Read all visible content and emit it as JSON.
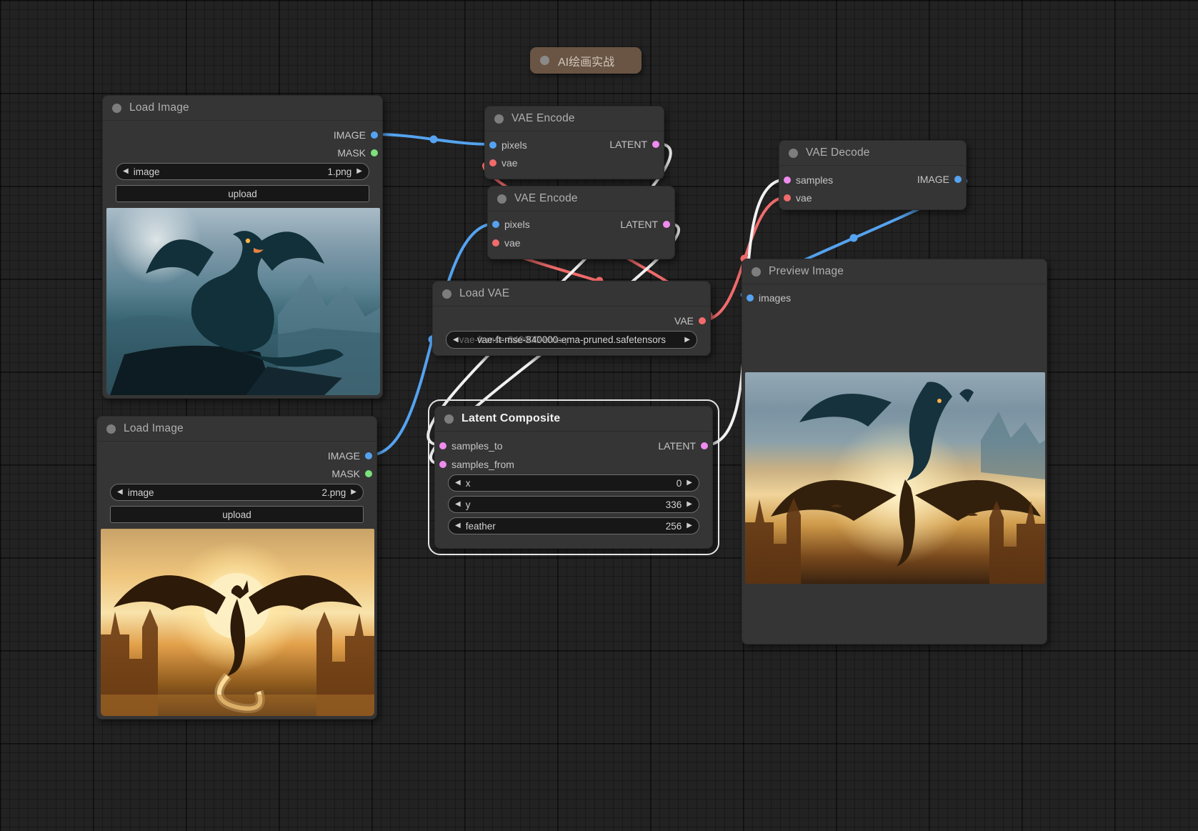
{
  "group": {
    "title": "AI绘画实战",
    "color": "#6a5443"
  },
  "icons": {
    "arrow_left": "◀",
    "arrow_right": "▶"
  },
  "colors": {
    "image_port": "#55a3f0",
    "mask_port": "#7ce07c",
    "latent_port": "#ef8bef",
    "vae_port": "#f26b6b",
    "image_wire": "#55a3f0",
    "vae_wire": "#f26b6b",
    "latent_wire": "#f2f2f2",
    "node_bg": "#353535",
    "selected_outline": "#e4e4e4"
  },
  "nodes": {
    "load_image_1": {
      "title": "Load Image",
      "outputs": {
        "image": "IMAGE",
        "mask": "MASK"
      },
      "widgets": {
        "image": {
          "label": "image",
          "value": "1.png"
        },
        "upload": {
          "label": "upload"
        }
      }
    },
    "load_image_2": {
      "title": "Load Image",
      "outputs": {
        "image": "IMAGE",
        "mask": "MASK"
      },
      "widgets": {
        "image": {
          "label": "image",
          "value": "2.png"
        },
        "upload": {
          "label": "upload"
        }
      }
    },
    "vae_encode_1": {
      "title": "VAE Encode",
      "inputs": {
        "pixels": "pixels",
        "vae": "vae"
      },
      "outputs": {
        "latent": "LATENT"
      }
    },
    "vae_encode_2": {
      "title": "VAE Encode",
      "inputs": {
        "pixels": "pixels",
        "vae": "vae"
      },
      "outputs": {
        "latent": "LATENT"
      }
    },
    "vae_decode": {
      "title": "VAE Decode",
      "inputs": {
        "samples": "samples",
        "vae": "vae"
      },
      "outputs": {
        "image": "IMAGE"
      }
    },
    "load_vae": {
      "title": "Load VAE",
      "outputs": {
        "vae": "VAE"
      },
      "widgets": {
        "vae_name": {
          "value": "vae-ft-mse-840000-ema-pruned.safetensors"
        }
      }
    },
    "latent_composite": {
      "title": "Latent Composite",
      "selected": true,
      "inputs": {
        "samples_to": "samples_to",
        "samples_from": "samples_from"
      },
      "outputs": {
        "latent": "LATENT"
      },
      "widgets": {
        "x": {
          "label": "x",
          "value": "0"
        },
        "y": {
          "label": "y",
          "value": "336"
        },
        "feather": {
          "label": "feather",
          "value": "256"
        }
      }
    },
    "preview_image": {
      "title": "Preview Image",
      "inputs": {
        "images": "images"
      }
    }
  }
}
